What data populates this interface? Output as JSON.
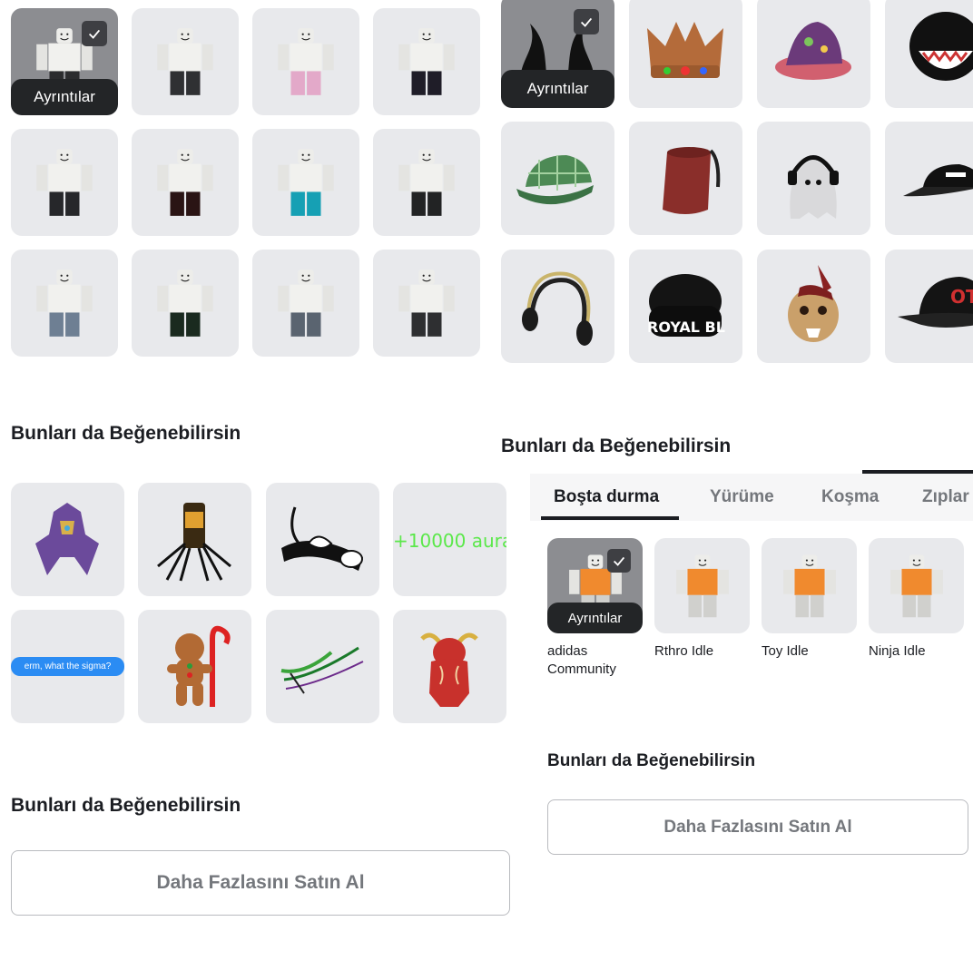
{
  "details_label": "Ayrıntılar",
  "section_heading": "Bunları da Beğenebilirsin",
  "buy_more_label": "Daha Fazlasını Satın Al",
  "clothing_grid": {
    "items": [
      {
        "pants": "#2b2c2e",
        "selected": true
      },
      {
        "pants": "#2f3033"
      },
      {
        "pants": "#e3a9c9"
      },
      {
        "pants": "#1f1d28"
      },
      {
        "pants": "#26272a"
      },
      {
        "pants": "#2a1414"
      },
      {
        "pants": "#16a0b4"
      },
      {
        "pants": "#222324"
      },
      {
        "pants": "#6e7f93"
      },
      {
        "pants": "#1a2a1f"
      },
      {
        "pants": "#5a6470"
      },
      {
        "pants": "#2e2f31"
      }
    ]
  },
  "accessory_grid": {
    "items": [
      {
        "name": "dark-horns",
        "icon": "horns-icon",
        "selected": true
      },
      {
        "name": "gingerbread-crown",
        "icon": "crown-icon"
      },
      {
        "name": "mushroom-hat",
        "icon": "mushroom-hat-icon"
      },
      {
        "name": "shark-hood",
        "icon": "shark-hood-icon"
      },
      {
        "name": "plaid-cap",
        "icon": "plaid-cap-icon"
      },
      {
        "name": "fez",
        "icon": "fez-icon"
      },
      {
        "name": "ghost-headphones",
        "icon": "ghost-icon"
      },
      {
        "name": "roblox-cap",
        "icon": "cap-icon"
      },
      {
        "name": "headphones",
        "icon": "headphones-icon"
      },
      {
        "name": "royal-beanie",
        "icon": "beanie-icon",
        "text": "ROYAL BL"
      },
      {
        "name": "bear-mask",
        "icon": "mask-icon"
      },
      {
        "name": "otp-cap",
        "icon": "snapback-icon",
        "text": "OTP"
      }
    ]
  },
  "recommended_left": {
    "items": [
      {
        "icon": "purple-robot-icon"
      },
      {
        "icon": "spider-can-icon"
      },
      {
        "icon": "ninja-drawing-icon"
      },
      {
        "icon": "aura-text-icon",
        "text": "+10000 aura"
      },
      {
        "icon": "chat-bubble-icon",
        "text": "erm, what the sigma?"
      },
      {
        "icon": "gingerbread-icon"
      },
      {
        "icon": "slash-effect-icon"
      },
      {
        "icon": "red-bull-icon"
      }
    ]
  },
  "animation_tabs": [
    "Boşta durma",
    "Yürüme",
    "Koşma",
    "Zıplar"
  ],
  "animation_items": [
    {
      "caption": "adidas Community",
      "selected": true
    },
    {
      "caption": "Rthro Idle"
    },
    {
      "caption": "Toy Idle"
    },
    {
      "caption": "Ninja Idle"
    }
  ]
}
